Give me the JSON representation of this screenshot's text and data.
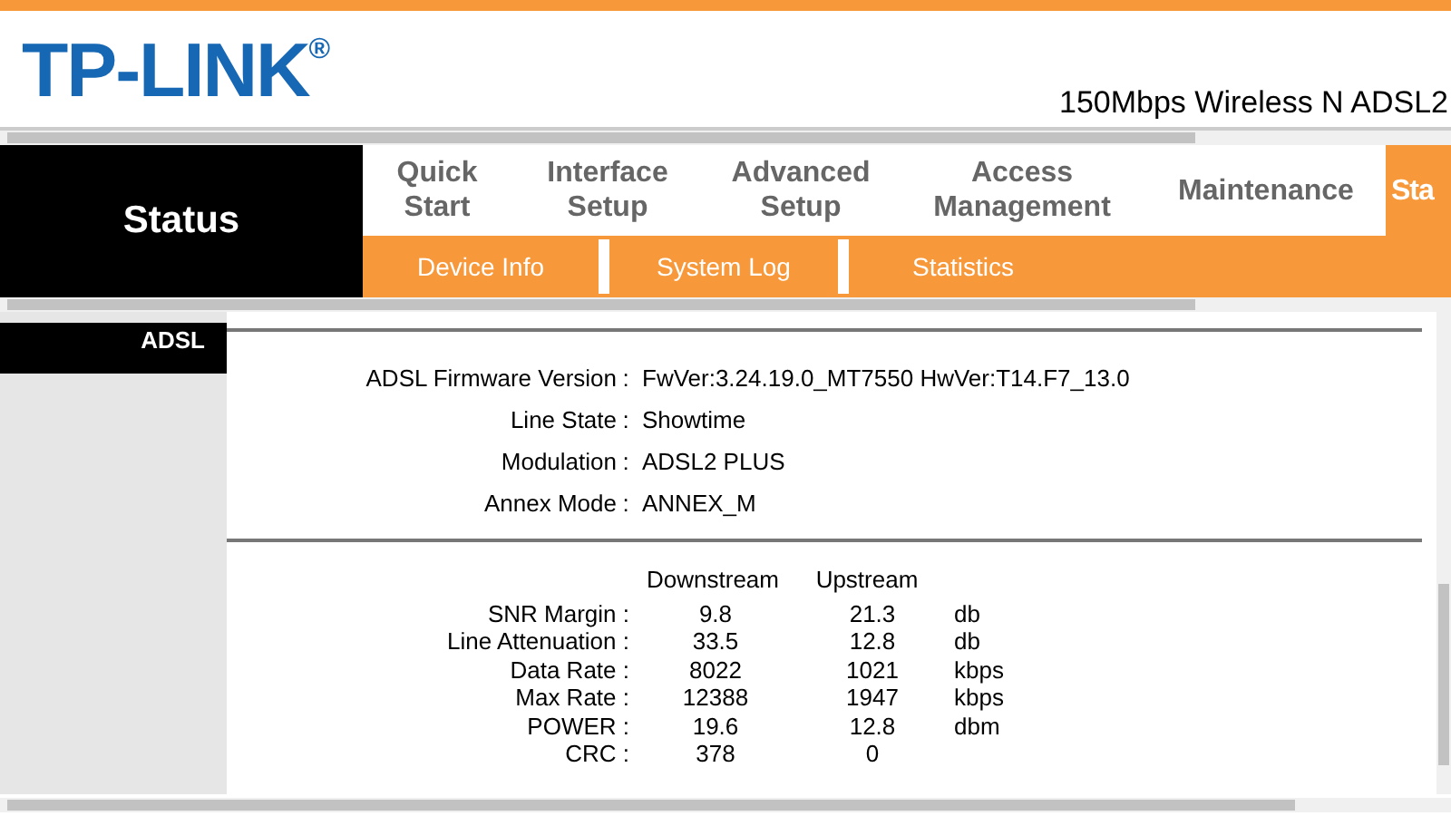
{
  "header": {
    "logo": "TP-LINK$^{®}$",
    "model": "150Mbps Wireless N ADSL2"
  },
  "section_title": "Status",
  "tabs": [
    {
      "label": "Quick\nStart",
      "selected": false
    },
    {
      "label": "Interface\nSetup",
      "selected": false
    },
    {
      "label": "Advanced\nSetup",
      "selected": false
    },
    {
      "label": "Access\nManagement",
      "selected": false
    },
    {
      "label": "Maintenance",
      "selected": false
    },
    {
      "label": "Sta",
      "selected": true
    }
  ],
  "subtabs": [
    {
      "label": "Device Info"
    },
    {
      "label": "System Log"
    },
    {
      "label": "Statistics"
    }
  ],
  "sidebar": {
    "heading": "ADSL"
  },
  "info": [
    {
      "label": "ADSL Firmware Version",
      "separator": ":",
      "value": "FwVer:3.24.19.0_MT7550 HwVer:T14.F7_13.0"
    },
    {
      "label": "Line State",
      "separator": ":",
      "value": "Showtime"
    },
    {
      "label": "Modulation",
      "separator": ":",
      "value": "ADSL2 PLUS"
    },
    {
      "label": "Annex Mode",
      "separator": ":",
      "value": "ANNEX_M"
    }
  ],
  "stats": {
    "columns": [
      "Downstream",
      "Upstream"
    ],
    "rows": [
      {
        "label": "SNR Margin :",
        "down": "9.8",
        "up": "21.3",
        "unit": "db"
      },
      {
        "label": "Line Attenuation :",
        "down": "33.5",
        "up": "12.8",
        "unit": "db"
      },
      {
        "label": "Data Rate :",
        "down": "8022",
        "up": "1021",
        "unit": "kbps"
      },
      {
        "label": "Max Rate :",
        "down": "12388",
        "up": "1947",
        "unit": "kbps"
      },
      {
        "label": "POWER :",
        "down": "19.6",
        "up": "12.8",
        "unit": "dbm"
      },
      {
        "label": "CRC :",
        "down": "378",
        "up": "0"
      }
    ]
  }
}
